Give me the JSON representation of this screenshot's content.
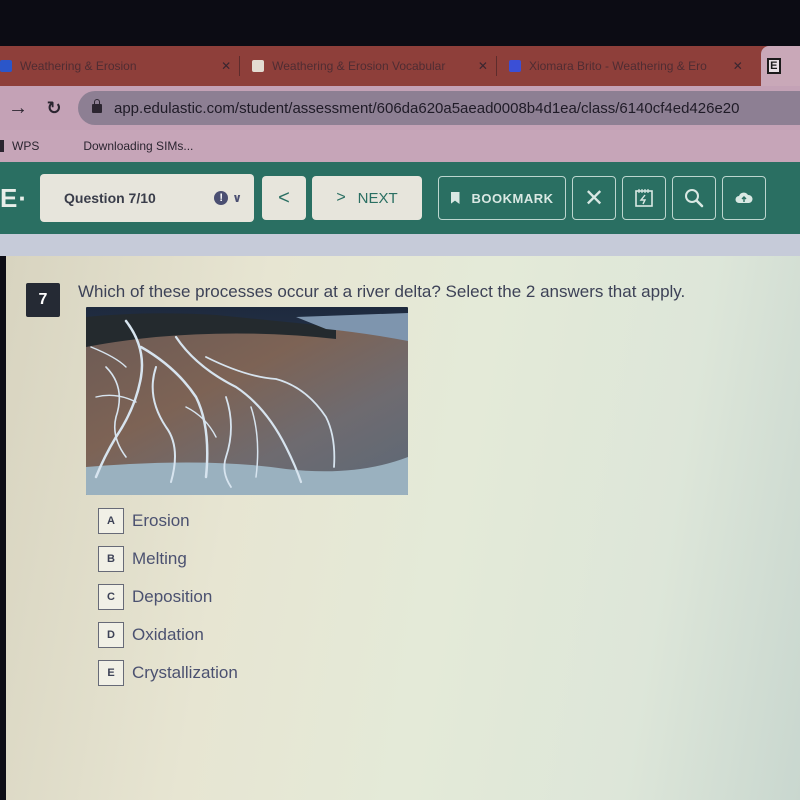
{
  "browser": {
    "tabs": [
      {
        "title": "Weathering & Erosion",
        "favicon": "doc-icon",
        "favicon_color": "#2b56c9"
      },
      {
        "title": "Weathering & Erosion Vocabular",
        "favicon": "slides-icon",
        "favicon_color": "#e3dcd2"
      },
      {
        "title": "Xiomara Brito - Weathering & Ero",
        "favicon": "docs-icon",
        "favicon_color": "#3b4fd6"
      }
    ],
    "new_tab_glyph": "E",
    "url": "app.edulastic.com/student/assessment/606da620a5aead0008b4d1ea/class/6140cf4ed426e20",
    "bookmarks": [
      {
        "label": "WPS"
      },
      {
        "label": "Downloading SIMs..."
      }
    ]
  },
  "toolbar": {
    "logo": "E·",
    "question_selector": "Question 7/10",
    "prev_label": "<",
    "next_label": "NEXT",
    "bookmark_label": "BOOKMARK",
    "accent_color": "#2a6f62"
  },
  "question": {
    "number": "7",
    "text": "Which of these processes occur at a river delta? Select the 2 answers that apply.",
    "image_alt": "Aerial photo of a braided river delta",
    "options": [
      {
        "letter": "A",
        "label": "Erosion"
      },
      {
        "letter": "B",
        "label": "Melting"
      },
      {
        "letter": "C",
        "label": "Deposition"
      },
      {
        "letter": "D",
        "label": "Oxidation"
      },
      {
        "letter": "E",
        "label": "Crystallization"
      }
    ]
  }
}
